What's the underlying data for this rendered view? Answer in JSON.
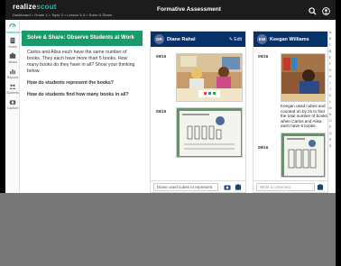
{
  "topbar": {
    "brand_a": "realize",
    "brand_b": "scout",
    "breadcrumb": "Dashboard > Grade 1 > Topic 3 > Lesson 3-3 > Solve & Share",
    "title": "Formative Assessment"
  },
  "rail": {
    "items": [
      {
        "label": "Dashboard",
        "icon": "dashboard-icon"
      },
      {
        "label": "Notes",
        "icon": "notes-icon"
      },
      {
        "label": "Media",
        "icon": "media-icon"
      },
      {
        "label": "Reports",
        "icon": "reports-icon"
      },
      {
        "label": "Students",
        "icon": "students-icon"
      },
      {
        "label": "Capture",
        "icon": "camera-icon"
      }
    ]
  },
  "prompt": {
    "header": "Solve & Share: Observe Students at Work",
    "para": "Carlos and Alisa each have the same number of books. They each have more than 5 books. How many books do they have in all? Show your thinking below.",
    "q1": "How do students represent the books?",
    "q2": "How do students find how many books in all?"
  },
  "cards": [
    {
      "initials": "DR",
      "name": "Diane Rahal",
      "edit": "✎ Edit",
      "date1": "09/16",
      "date2": "09/16",
      "comment": "Diane used cubes to represent",
      "comment_is_placeholder": false
    },
    {
      "initials": "KW",
      "name": "Keegan Williams",
      "date1": "09/16",
      "date2": "09/16",
      "note": "Keegan used cubes and counted on by 2s to find the total number of books when Carlos and Alisa each have 6 books.",
      "comment": "Write a comment",
      "comment_is_placeholder": true
    }
  ],
  "alphabet": [
    "A",
    "B",
    "C",
    "D",
    "E",
    "F",
    "G",
    "H",
    "I",
    "J",
    "K",
    "L",
    "M",
    "N",
    "O",
    "P",
    "Q",
    "R",
    "S"
  ],
  "alphabet_selected": "D",
  "colors": {
    "prompt_header": "#199a6b",
    "card_header": "#06326b",
    "brand_accent": "#31b3a1"
  }
}
